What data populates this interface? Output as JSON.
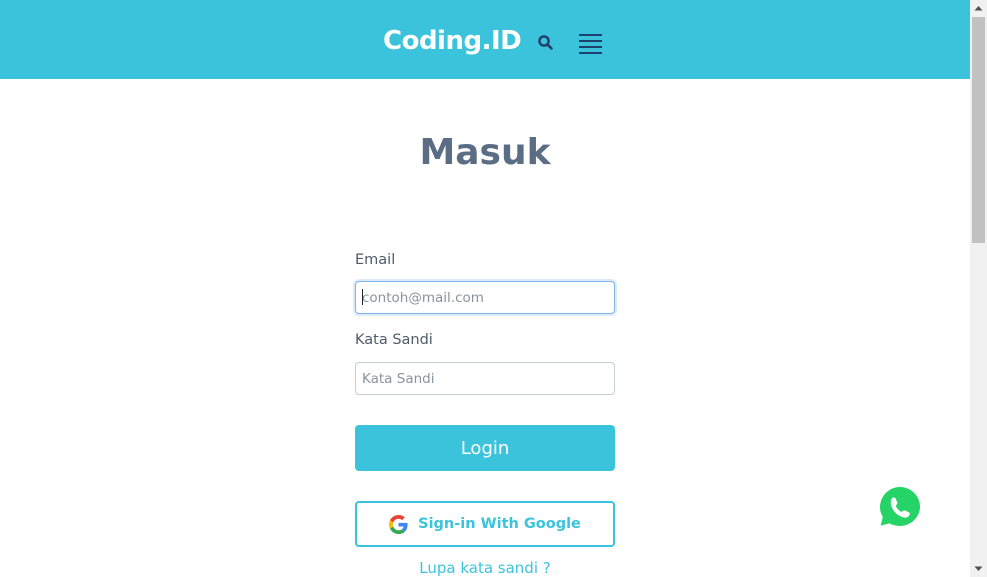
{
  "header": {
    "logo": "Coding.ID",
    "search_icon": "search-icon",
    "menu_icon": "hamburger-menu-icon",
    "bg_color": "#3cc3dc"
  },
  "page": {
    "title": "Masuk"
  },
  "form": {
    "email_label": "Email",
    "email_placeholder": "contoh@mail.com",
    "email_value": "",
    "password_label": "Kata Sandi",
    "password_placeholder": "Kata Sandi",
    "password_value": "",
    "login_label": "Login",
    "google_label": "Sign-in With Google",
    "google_icon": "google-icon",
    "forgot_label": "Lupa kata sandi ?"
  },
  "floating": {
    "whatsapp_icon": "whatsapp-icon",
    "whatsapp_color": "#25d366"
  },
  "colors": {
    "accent": "#3cc3dc",
    "title_text": "#5b6d84"
  }
}
